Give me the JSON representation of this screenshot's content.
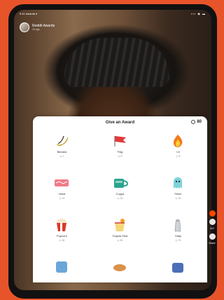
{
  "status": {
    "time": "9:41  Awards ▾",
    "right": "▪▪▪ ◉ ▬"
  },
  "profile": {
    "name": "Reddit Awards",
    "sub": "1h ago"
  },
  "sheet": {
    "title": "Give an Award",
    "coins": "80",
    "awards": [
      {
        "label": "Banana",
        "cost": "1"
      },
      {
        "label": "Flag",
        "cost": "5"
      },
      {
        "label": "Lit",
        "cost": "5"
      },
      {
        "label": "Yeeet",
        "cost": "10"
      },
      {
        "label": "Cuppa",
        "cost": "20"
      },
      {
        "label": "Fetch",
        "cost": "25"
      },
      {
        "label": "Popcorn",
        "cost": "50"
      },
      {
        "label": "Tequila Shot",
        "cost": "50"
      },
      {
        "label": "Salty",
        "cost": "75"
      }
    ]
  },
  "side": {
    "comments": "412",
    "share": "Share"
  }
}
